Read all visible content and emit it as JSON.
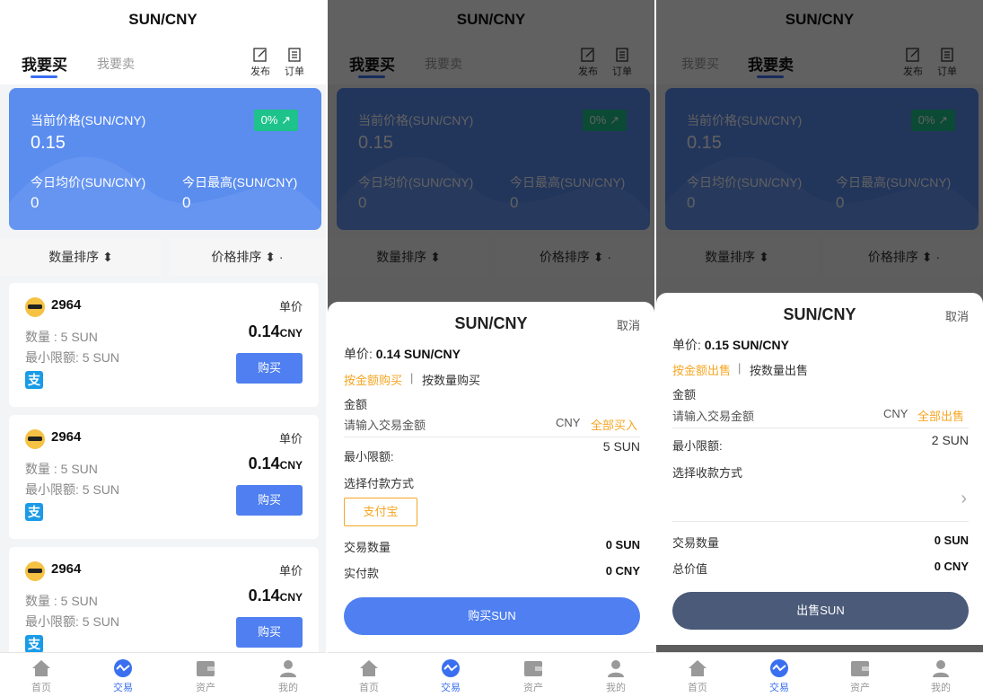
{
  "title": "SUN/CNY",
  "tabs": {
    "buy": "我要买",
    "sell": "我要卖"
  },
  "tools": {
    "publish": "发布",
    "orders": "订单"
  },
  "price_card": {
    "current_label": "当前价格(SUN/CNY)",
    "current_value": "0.15",
    "change": "0%",
    "avg_label": "今日均价(SUN/CNY)",
    "avg_value": "0",
    "high_label": "今日最高(SUN/CNY)",
    "high_value": "0"
  },
  "sort": {
    "qty": "数量排序 ⬍",
    "price": "价格排序 ⬍ ·"
  },
  "listings": [
    {
      "user": "2964",
      "qty": "数量 : 5 SUN",
      "min": "最小限额: 5 SUN",
      "unit_label": "单价",
      "price": "0.14",
      "currency": "CNY",
      "button": "购买",
      "pay_icon": "支"
    },
    {
      "user": "2964",
      "qty": "数量 : 5 SUN",
      "min": "最小限额: 5 SUN",
      "unit_label": "单价",
      "price": "0.14",
      "currency": "CNY",
      "button": "购买",
      "pay_icon": "支"
    },
    {
      "user": "2964",
      "qty": "数量 : 5 SUN",
      "min": "最小限额: 5 SUN",
      "unit_label": "单价",
      "price": "0.14",
      "currency": "CNY",
      "button": "购买",
      "pay_icon": "支"
    }
  ],
  "nav": {
    "home": "首页",
    "trade": "交易",
    "assets": "资产",
    "mine": "我的"
  },
  "buy_sheet": {
    "title": "SUN/CNY",
    "cancel": "取消",
    "unit_label": "单价:",
    "unit_value": "0.14 SUN/CNY",
    "mode_amount": "按金额购买",
    "mode_sep": "|",
    "mode_qty": "按数量购买",
    "amount_label": "金额",
    "amount_placeholder": "请输入交易金额",
    "currency": "CNY",
    "all": "全部买入",
    "min_label": "最小限额:",
    "min_value": "5 SUN",
    "pay_label": "选择付款方式",
    "pay_option": "支付宝",
    "trade_qty_label": "交易数量",
    "trade_qty_value": "0 SUN",
    "paid_label": "实付款",
    "paid_value": "0 CNY",
    "button": "购买SUN"
  },
  "sell_sheet": {
    "title": "SUN/CNY",
    "cancel": "取消",
    "unit_label": "单价:",
    "unit_value": "0.15 SUN/CNY",
    "mode_amount": "按金额出售",
    "mode_sep": "|",
    "mode_qty": "按数量出售",
    "amount_label": "金额",
    "amount_placeholder": "请输入交易金额",
    "currency": "CNY",
    "all": "全部出售",
    "min_label": "最小限额:",
    "min_value": "2 SUN",
    "receive_label": "选择收款方式",
    "trade_qty_label": "交易数量",
    "trade_qty_value": "0 SUN",
    "total_label": "总价值",
    "total_value": "0 CNY",
    "button": "出售SUN"
  },
  "colors": {
    "primary": "#4f7ff0",
    "card": "#5b8def",
    "green": "#1ec28b",
    "orange": "#f5a623",
    "sell_button": "#4a5a78"
  }
}
